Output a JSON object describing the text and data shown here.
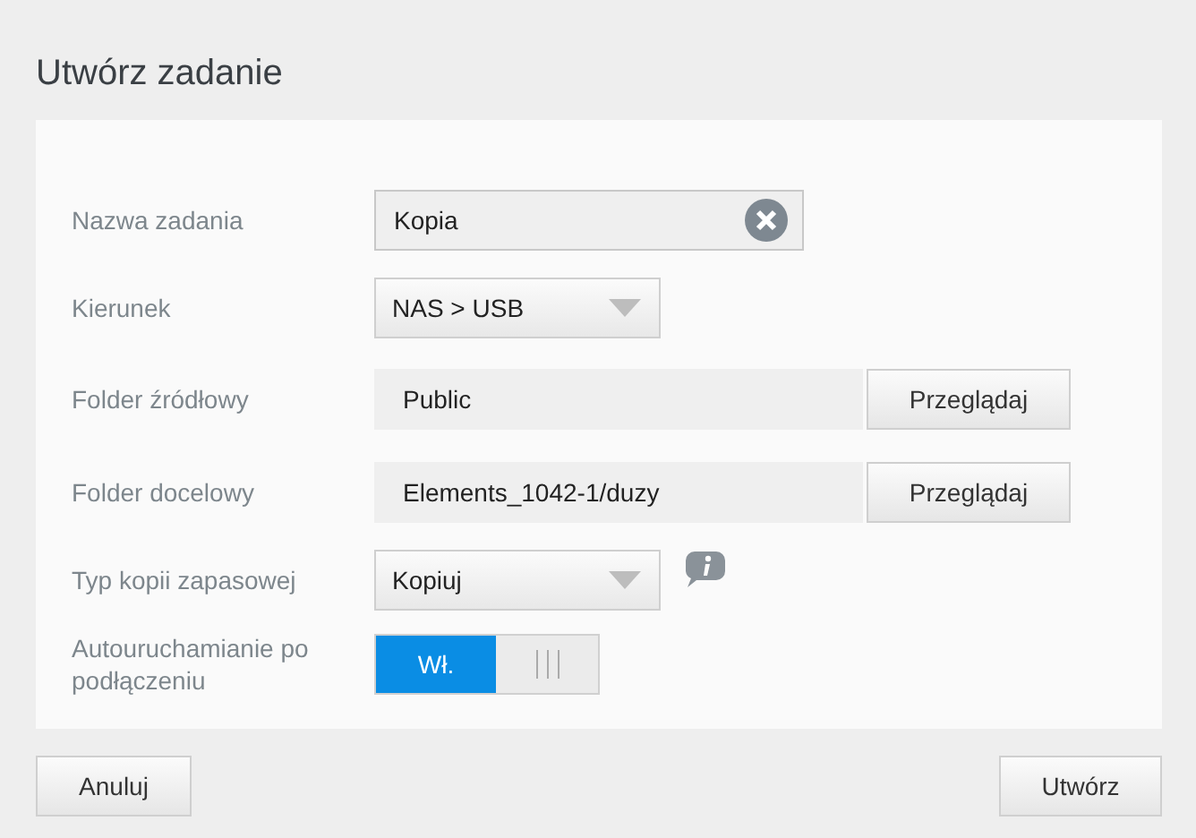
{
  "title": "Utwórz zadanie",
  "fields": [
    {
      "kind": "text",
      "label": "Nazwa zadania",
      "value": "Kopia"
    },
    {
      "kind": "select",
      "label": "Kierunek",
      "value": "NAS > USB"
    },
    {
      "kind": "folder",
      "label": "Folder źródłowy",
      "value": "Public",
      "button": "Przeglądaj"
    },
    {
      "kind": "folder",
      "label": "Folder docelowy",
      "value": "Elements_1042-1/duzy",
      "button": "Przeglądaj"
    },
    {
      "kind": "select-info",
      "label": "Typ kopii zapasowej",
      "value": "Kopiuj"
    },
    {
      "kind": "toggle",
      "label": "Autouruchamianie po podłączeniu",
      "on": true,
      "on_label": "Wł."
    }
  ],
  "buttons": [
    "Anuluj",
    "Utwórz"
  ]
}
